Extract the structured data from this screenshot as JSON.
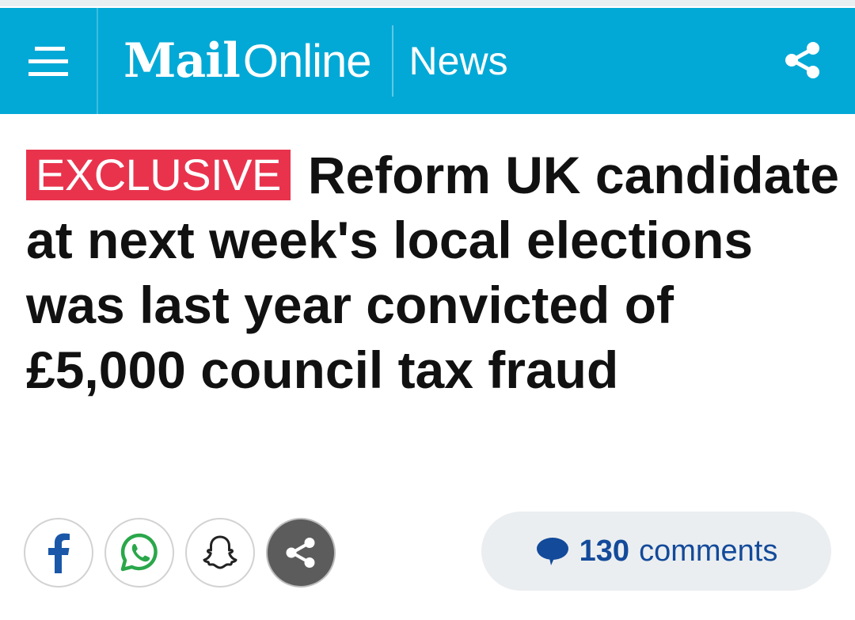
{
  "header": {
    "logo_mail": "Mail",
    "logo_online": "Online",
    "section": "News",
    "background": "#03a9d6"
  },
  "article": {
    "badge": "EXCLUSIVE",
    "badge_color": "#e9334d",
    "headline": "Reform UK candidate at next week's local elections was last year convicted of £5,000 council tax fraud"
  },
  "share": {
    "buttons": [
      "facebook-icon",
      "whatsapp-icon",
      "snapchat-icon",
      "share-icon"
    ]
  },
  "comments": {
    "count": "130",
    "label": "comments",
    "color": "#134a9a"
  }
}
